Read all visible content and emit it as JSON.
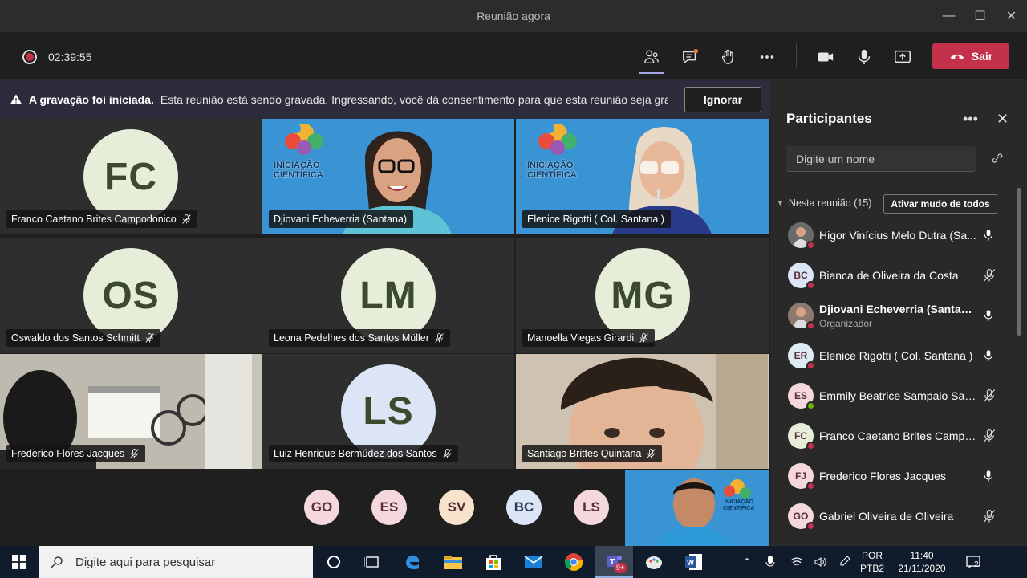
{
  "window": {
    "title": "Reunião agora",
    "minimize": "—",
    "maximize": "☐",
    "close": "✕"
  },
  "toolbar": {
    "timer": "02:39:55",
    "leave_label": "Sair",
    "icons": [
      "participants-icon",
      "chat-icon",
      "raise-hand-icon",
      "more-icon",
      "camera-icon",
      "mic-icon",
      "share-icon"
    ]
  },
  "banner": {
    "title": "A gravação foi iniciada.",
    "message": "Esta reunião está sendo gravada. Ingressando, você dá consentimento para que esta reunião seja gra...",
    "ignore_label": "Ignorar"
  },
  "tiles": [
    {
      "name": "Franco Caetano Brites Campodonico",
      "initials": "FC",
      "bg": "#e6eed9"
    },
    {
      "name": "Djiovani Echeverria (Santana)",
      "video": true
    },
    {
      "name": "Elenice Rigotti ( Col. Santana )",
      "video": true
    },
    {
      "name": "Oswaldo dos Santos Schmitt",
      "initials": "OS",
      "bg": "#e6eed9"
    },
    {
      "name": "Leona Pedelhes dos Santos Müller",
      "initials": "LM",
      "bg": "#e6eed9"
    },
    {
      "name": "Manoella Viegas Girardi",
      "initials": "MG",
      "bg": "#e6eed9"
    },
    {
      "name": "Frederico Flores Jacques",
      "video": true
    },
    {
      "name": "Luiz Henrique Bermúdez dos Santos",
      "initials": "LS",
      "bg": "#dbe5f5"
    },
    {
      "name": "Santiago Brittes Quintana",
      "video": true
    }
  ],
  "overflow": [
    {
      "initials": "GO",
      "bg": "#f4d8dc"
    },
    {
      "initials": "ES",
      "bg": "#f4d8dc"
    },
    {
      "initials": "SV",
      "bg": "#f7e3cc"
    },
    {
      "initials": "BC",
      "bg": "#dbe5f5"
    },
    {
      "initials": "LS",
      "bg": "#f4d8dc"
    }
  ],
  "video_logo": {
    "line1": "INICIAÇÃO",
    "line2": "CIENTÍFICA"
  },
  "panel": {
    "title": "Participantes",
    "search_placeholder": "Digite um nome",
    "group_label": "Nesta reunião (15)",
    "mute_all_label": "Ativar mudo de todos",
    "participants": [
      {
        "name": "Higor Vinícius Melo Dutra (Sa...",
        "initials": "",
        "photo": true,
        "bg": "#6a6a6a",
        "muted": false
      },
      {
        "name": "Bianca de Oliveira da Costa",
        "initials": "BC",
        "bg": "#dbe5f5",
        "muted": true
      },
      {
        "name": "Djiovani Echeverria (Santana)",
        "sub": "Organizador",
        "initials": "",
        "photo": true,
        "bg": "#8a7a70",
        "muted": false
      },
      {
        "name": "Elenice Rigotti ( Col. Santana )",
        "initials": "ER",
        "bg": "#dcecf3",
        "muted": false
      },
      {
        "name": "Emmily Beatrice Sampaio Sart...",
        "initials": "ES",
        "bg": "#f4d8dc",
        "muted": true,
        "green": true
      },
      {
        "name": "Franco Caetano Brites Campo...",
        "initials": "FC",
        "bg": "#e6eed9",
        "muted": true
      },
      {
        "name": "Frederico Flores Jacques",
        "initials": "FJ",
        "bg": "#f4d8dc",
        "muted": false
      },
      {
        "name": "Gabriel Oliveira de Oliveira",
        "initials": "GO",
        "bg": "#f4d8dc",
        "muted": true
      }
    ]
  },
  "taskbar": {
    "search_placeholder": "Digite aqui para pesquisar",
    "lang1": "POR",
    "lang2": "PTB2",
    "time": "11:40",
    "date": "21/11/2020",
    "teams_badge": "9+",
    "notif_count": "2"
  }
}
